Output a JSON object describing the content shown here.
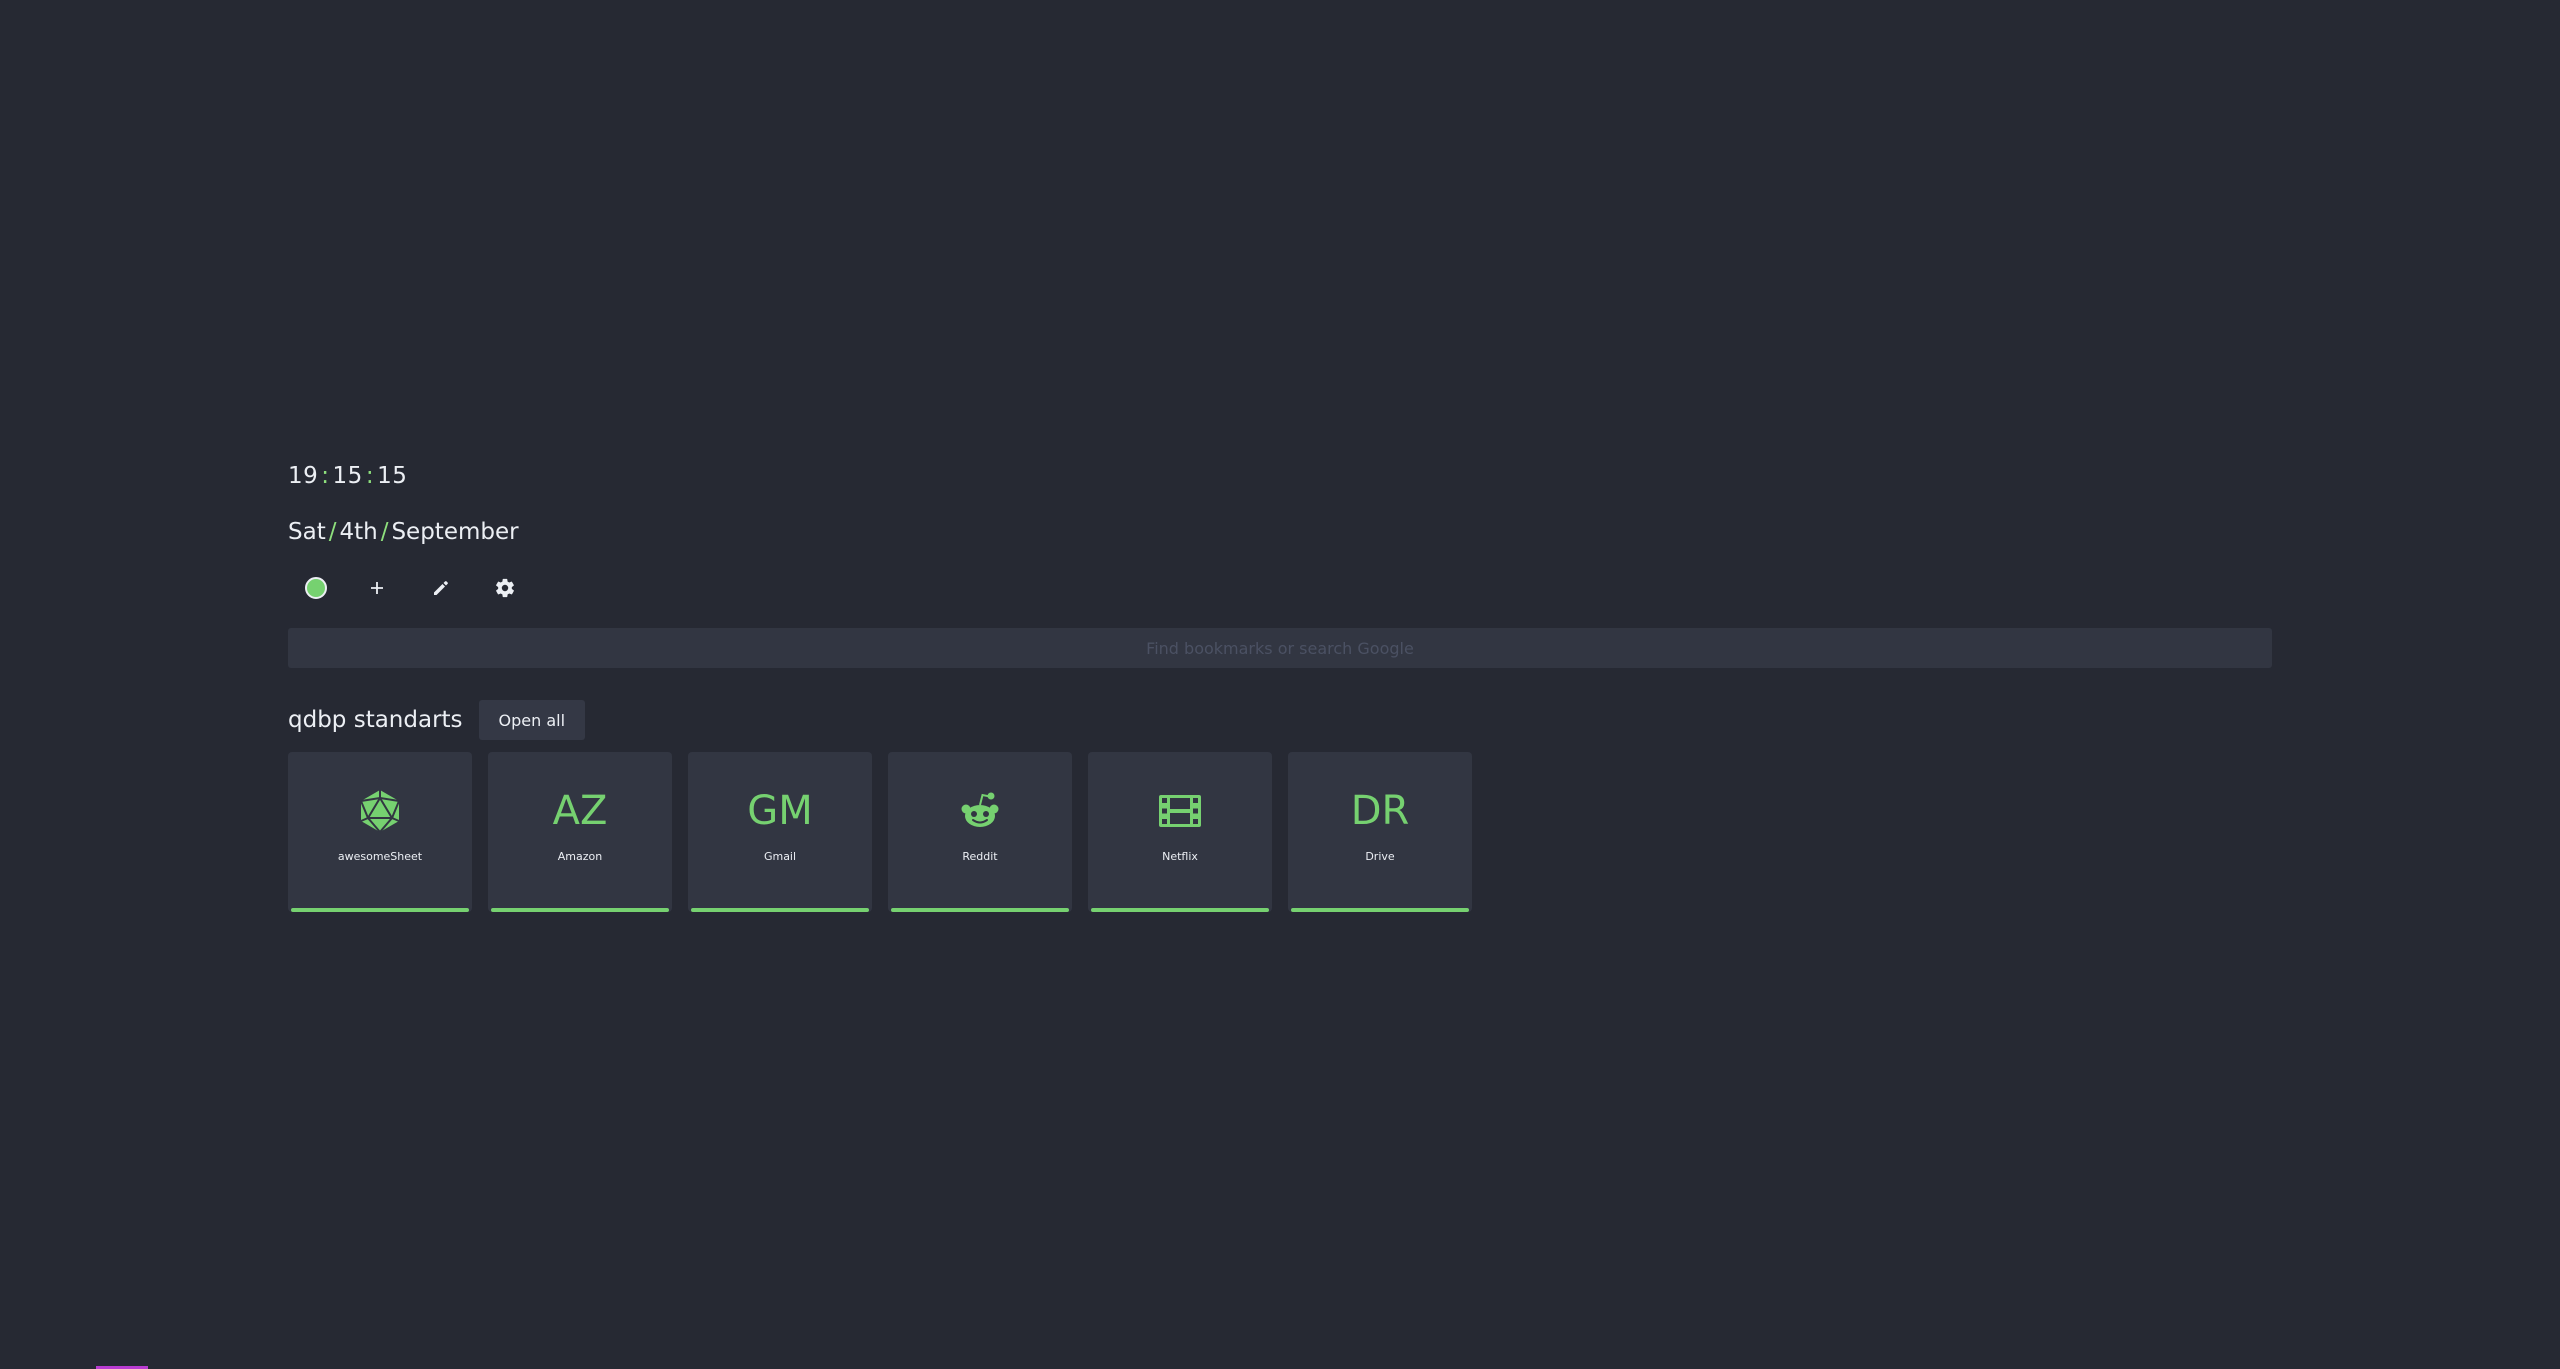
{
  "clock": {
    "hours": "19",
    "minutes": "15",
    "seconds": "15",
    "separator": ":"
  },
  "date": {
    "day": "Sat",
    "date": "4th",
    "month": "September",
    "separator": "/"
  },
  "controls": [
    {
      "name": "theme-dot",
      "icon": "circle-icon"
    },
    {
      "name": "add",
      "icon": "plus-icon"
    },
    {
      "name": "edit",
      "icon": "pencil-icon"
    },
    {
      "name": "settings",
      "icon": "gear-icon"
    }
  ],
  "search": {
    "placeholder": "Find bookmarks or search Google",
    "value": ""
  },
  "group": {
    "title": "qdbp standarts",
    "open_all_label": "Open all",
    "bookmarks": [
      {
        "label": "awesomeSheet",
        "display": "icon",
        "icon": "d20-icon"
      },
      {
        "label": "Amazon",
        "display": "letters",
        "letters": "AZ"
      },
      {
        "label": "Gmail",
        "display": "letters",
        "letters": "GM"
      },
      {
        "label": "Reddit",
        "display": "icon",
        "icon": "reddit-icon"
      },
      {
        "label": "Netflix",
        "display": "icon",
        "icon": "film-icon"
      },
      {
        "label": "Drive",
        "display": "letters",
        "letters": "DR"
      }
    ]
  },
  "colors": {
    "background": "#262933",
    "accent": "#76d170",
    "surface": "#323642",
    "text": "#eceff4"
  }
}
